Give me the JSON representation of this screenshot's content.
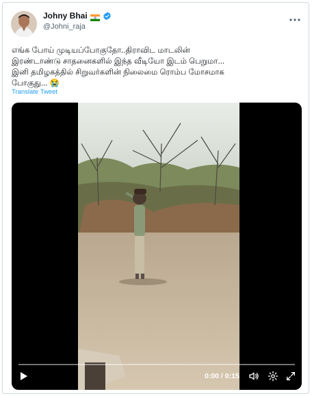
{
  "author": {
    "display_name": "Johny Bhai",
    "handle": "@Johni_raja",
    "flag_icon": "india-flag-icon",
    "verified_icon": "verified-badge-icon"
  },
  "tweet": {
    "text": "எங்க போய் முடியப்போகுதோ..திராவிட மாடலின்\nஇரண்டாண்டு சாதனைகளில் இந்த வீடியோ இடம் பெறுமா...\nஇனி தமிழகத்தில் சிறுவர்களின் நிலைமை ரொம்ப மோசமாக\nபோகுது... 😭",
    "translate_label": "Translate Tweet"
  },
  "video": {
    "current_time": "0:00",
    "duration": "0:15",
    "time_separator": " / ",
    "progress": 0.0
  },
  "colors": {
    "link": "#1d9bf0",
    "secondary_text": "#536471",
    "border": "#cfd9de"
  }
}
